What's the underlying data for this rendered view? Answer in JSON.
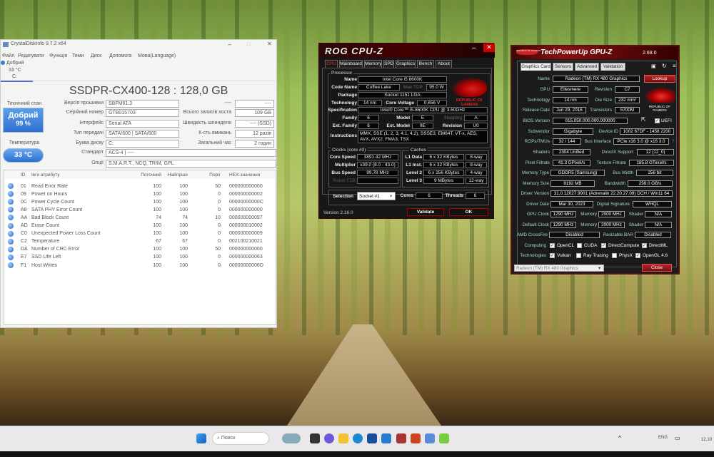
{
  "cdi": {
    "title": "CrystalDiskInfo 9.7.2 x64",
    "menu": [
      "Файл",
      "Редагувати",
      "Функція",
      "Теми",
      "Диск",
      "Допомога",
      "Мова(Language)"
    ],
    "disk_tab": {
      "status": "Добрий",
      "temp": "33 °C",
      "letter": "C:"
    },
    "disk_title": "SSDPR-CX400-128 : 128,0 GB",
    "health_label": "Технічний стан",
    "health_status": "Добрий",
    "health_percent": "99 %",
    "temp_label": "Температура",
    "temp_value": "33 °C",
    "fields": [
      {
        "label": "Версія прошивки",
        "value": "SBFM61.3"
      },
      {
        "label": "Серійний номер",
        "value": "GTB015703"
      },
      {
        "label": "Інтерфейс",
        "value": "Serial ATA"
      },
      {
        "label": "Тип передачі",
        "value": "SATA/600 | SATA/600"
      },
      {
        "label": "Буква диску",
        "value": "C:"
      },
      {
        "label": "Стандарт",
        "value": "ACS-4 | ----"
      },
      {
        "label": "Опції",
        "value": "S.M.A.R.T., NCQ, TRIM, GPL"
      }
    ],
    "right_fields": [
      {
        "label": "----",
        "value": "----"
      },
      {
        "label": "Всього записів хоста",
        "value": "109 GB"
      },
      {
        "label": "Швидкість шпинделя",
        "value": "---- (SSD)"
      },
      {
        "label": "К-сть вмикань",
        "value": "12 разів"
      },
      {
        "label": "Загальний час",
        "value": "2 годин"
      }
    ],
    "columns": [
      "ID",
      "Ім'я атрибуту",
      "Поточний",
      "Найгірше",
      "Поріг",
      "HEX-значення"
    ],
    "rows": [
      [
        "01",
        "Read Error Rate",
        "100",
        "100",
        "50",
        "000000000000"
      ],
      [
        "09",
        "Power on Hours",
        "100",
        "100",
        "0",
        "000000000002"
      ],
      [
        "0C",
        "Power Cycle Count",
        "100",
        "100",
        "0",
        "00000000000C"
      ],
      [
        "A8",
        "SATA PHY Error Count",
        "100",
        "100",
        "0",
        "000000000000"
      ],
      [
        "AA",
        "Bad Block Count",
        "74",
        "74",
        "10",
        "000000000097"
      ],
      [
        "AD",
        "Erase Count",
        "100",
        "100",
        "0",
        "000000010002"
      ],
      [
        "C0",
        "Unexpected Power Loss Count",
        "100",
        "100",
        "0",
        "000000000009"
      ],
      [
        "C2",
        "Temperature",
        "67",
        "67",
        "0",
        "002100210021"
      ],
      [
        "DA",
        "Number of CRC Error",
        "100",
        "100",
        "50",
        "000000000000"
      ],
      [
        "E7",
        "SSD Life Left",
        "100",
        "100",
        "0",
        "000000000063"
      ],
      [
        "F1",
        "Host Writes",
        "100",
        "100",
        "0",
        "00000000006D"
      ]
    ],
    "colors": {
      "good": "#3a7fd9"
    }
  },
  "cpuz": {
    "title": "ROG CPU-Z",
    "tabs": [
      "CPU",
      "Mainboard",
      "Memory",
      "SPD",
      "Graphics",
      "Bench",
      "About"
    ],
    "processor_group": "Processor",
    "name_label": "Name",
    "name": "Intel Core i5 8600K",
    "codename_label": "Code Name",
    "codename": "Coffee Lake",
    "maxtdp_label": "Max TDP",
    "maxtdp": "95.0 W",
    "package_label": "Package",
    "package": "Socket 1151 LGA",
    "tech_label": "Technology",
    "tech": "14 nm",
    "voltage_label": "Core Voltage",
    "voltage": "0.656 V",
    "logo_text": "REPUBLIC OF GAMERS",
    "spec_label": "Specification",
    "spec": "Intel® Core™ i5-8600K CPU @ 3.60GHz",
    "family_label": "Family",
    "family": "6",
    "model_label": "Model",
    "model": "E",
    "stepping_label": "Stepping",
    "stepping": "A",
    "extfamily_label": "Ext. Family",
    "extfamily": "6",
    "extmodel_label": "Ext. Model",
    "extmodel": "9E",
    "revision_label": "Revision",
    "revision": "U0",
    "instr_label": "Instructions",
    "instr": "MMX, SSE (1, 2, 3, 4.1, 4.2), SSSE3, EM64T, VT-x, AES, AVX, AVX2, FMA3, TSX",
    "clocks_group": "Clocks (core #0)",
    "corespeed_label": "Core Speed",
    "corespeed": "3891.42 MHz",
    "mult_label": "Multiplier",
    "mult": "x39.0 (8.0 - 43.0)",
    "bus_label": "Bus Speed",
    "bus": "99.78 MHz",
    "fsb_label": "Rated FSB",
    "caches_group": "Caches",
    "l1d_label": "L1 Data",
    "l1d": "6 x 32 KBytes",
    "l1d_way": "8-way",
    "l1i_label": "L1 Inst.",
    "l1i": "6 x 32 KBytes",
    "l1i_way": "8-way",
    "l2_label": "Level 2",
    "l2": "6 x 256 KBytes",
    "l2_way": "4-way",
    "l3_label": "Level 3",
    "l3": "9 MBytes",
    "l3_way": "12-way",
    "selection_label": "Selection",
    "selection": "Socket #1",
    "cores_label": "Cores",
    "cores": "6",
    "threads_label": "Threads",
    "threads": "6",
    "version": "Version 2.16.0",
    "validate": "Validate",
    "ok": "OK"
  },
  "gpuz": {
    "title": "TechPowerUp GPU-Z",
    "version": "2.68.0",
    "title_logo": "REPUBLIC OF GAMERS",
    "tabs": [
      "Graphics Card",
      "Sensors",
      "Advanced",
      "Validation"
    ],
    "lookup": "Lookup",
    "logo_text": "REPUBLIC OF GAMERS",
    "rows": {
      "name_l": "Name",
      "name": "Radeon (TM) RX 480 Graphics",
      "gpu_l": "GPU",
      "gpu": "Ellesmere",
      "rev_l": "Revision",
      "rev": "C7",
      "tech_l": "Technology",
      "tech": "14 nm",
      "die_l": "Die Size",
      "die": "232 mm²",
      "rel_l": "Release Date",
      "rel": "Jun 29, 2016",
      "tr_l": "Transistors",
      "tr": "5700M",
      "bios_l": "BIOS Version",
      "bios": "015.050.000.000.000000",
      "uefi": "UEFI",
      "sub_l": "Subvendor",
      "sub": "Gigabyte",
      "dev_l": "Device ID",
      "dev": "1002 67DF - 1458 2200",
      "rops_l": "ROPs/TMUs",
      "rops": "32 / 144",
      "bus_l": "Bus Interface",
      "bus": "PCIe x16 3.0 @ x16 3.0",
      "q": "?",
      "sh_l": "Shaders",
      "sh": "2304 Unified",
      "dx_l": "DirectX Support",
      "dx": "12 (12_0)",
      "px_l": "Pixel Fillrate",
      "px": "41.3 GPixel/s",
      "tx_l": "Texture Fillrate",
      "tx": "185.8 GTexel/s",
      "mt_l": "Memory Type",
      "mt": "GDDR5 (Samsung)",
      "bw_l": "Bus Width",
      "bw": "256 bit",
      "ms_l": "Memory Size",
      "ms": "8192 MB",
      "band_l": "Bandwidth",
      "band": "256.0 GB/s",
      "dv_l": "Driver Version",
      "dv": "31.0.12027.9001 (Adrenalin 22.20.27.09) DCH / Win11 64",
      "dd_l": "Driver Date",
      "dd": "Mar 30, 2023",
      "ds_l": "Digital Signature",
      "ds": "WHQL",
      "gc_l": "GPU Clock",
      "gc": "1290 MHz",
      "gm_l": "Memory",
      "gm": "2000 MHz",
      "gs_l": "Shader",
      "gs": "N/A",
      "dc_l": "Default Clock",
      "dc": "1290 MHz",
      "dm_l": "Memory",
      "dm": "2000 MHz",
      "dsh_l": "Shader",
      "dsh": "N/A",
      "cf_l": "AMD CrossFire",
      "cf": "Disabled",
      "rb_l": "Resizable BAR",
      "rb": "Disabled",
      "comp_l": "Computing",
      "tech2_l": "Technologies"
    },
    "computing": [
      {
        "label": "OpenCL",
        "checked": true
      },
      {
        "label": "CUDA",
        "checked": false
      },
      {
        "label": "DirectCompute",
        "checked": true
      },
      {
        "label": "DirectML",
        "checked": true
      }
    ],
    "technologies": [
      {
        "label": "Vulkan",
        "checked": true
      },
      {
        "label": "Ray Tracing",
        "checked": false
      },
      {
        "label": "PhysX",
        "checked": false
      },
      {
        "label": "OpenGL 4.6",
        "checked": true
      }
    ],
    "selected_gpu": "Radeon (TM) RX 480 Graphics",
    "close": "Close"
  },
  "taskbar": {
    "search": "Поиск",
    "lang": "ENG",
    "clock": "12.10"
  }
}
